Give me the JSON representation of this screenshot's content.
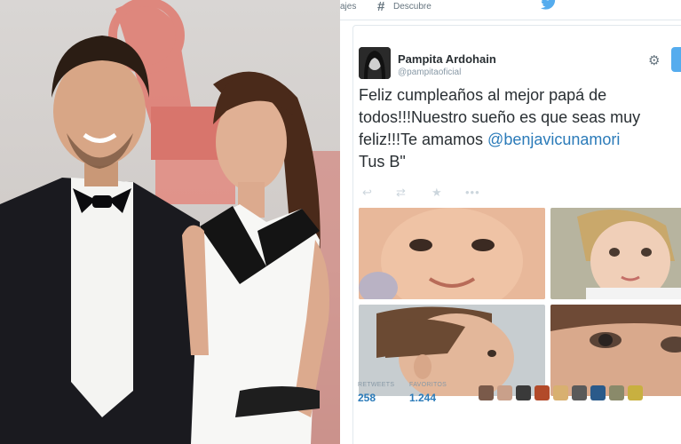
{
  "topbar": {
    "nav_left": "ajes",
    "discover": "Descubre",
    "icons": [
      "hash-icon",
      "twitter-bird-icon"
    ]
  },
  "tweet": {
    "author_name": "Pampita Ardohain",
    "author_handle": "@pampitaoficial",
    "text_before": "Feliz cumpleaños al mejor papá de todos!!!Nuestro sueño es que seas muy feliz!!!Te amamos ",
    "mention": "@benjavicunamori",
    "text_after": "\nTus B\"",
    "action_icons": [
      "reply-icon",
      "retweet-icon",
      "favorite-icon",
      "more-icon"
    ]
  },
  "stats": {
    "retweets_label": "RETWEETS",
    "retweets_value": "258",
    "favorites_label": "FAVORITOS",
    "favorites_value": "1.244"
  },
  "colors": {
    "accent": "#55acee",
    "link": "#2b7bb9",
    "text": "#292f33",
    "muted": "#8899a6"
  }
}
